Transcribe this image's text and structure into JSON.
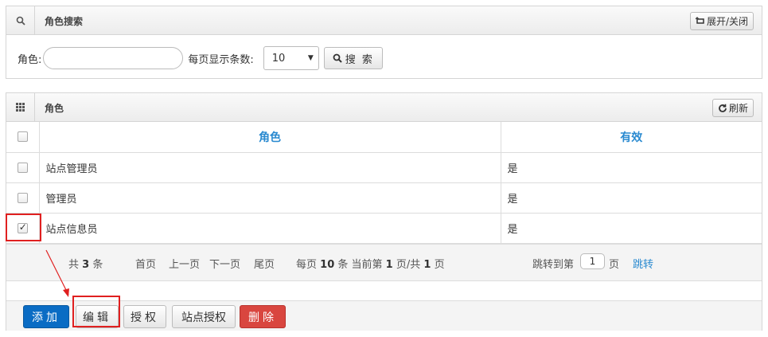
{
  "search_panel": {
    "title": "角色搜索",
    "toggle_label": "展开/关闭",
    "role_label": "角色:",
    "role_value": "",
    "page_size_label": "每页显示条数:",
    "page_size_value": "10",
    "search_label": "搜 索"
  },
  "roles_panel": {
    "title": "角色",
    "refresh_label": "刷新",
    "columns": [
      "角色",
      "有效"
    ],
    "rows": [
      {
        "role": "站点管理员",
        "valid": "是",
        "checked": false
      },
      {
        "role": "管理员",
        "valid": "是",
        "checked": false
      },
      {
        "role": "站点信息员",
        "valid": "是",
        "checked": true
      }
    ]
  },
  "pager": {
    "total_prefix": "共",
    "total": "3",
    "total_suffix": "条",
    "first": "首页",
    "prev": "上一页",
    "next": "下一页",
    "last": "尾页",
    "per_page_prefix": "每页",
    "per_page": "10",
    "per_page_mid": "条 当前第",
    "current_page": "1",
    "pages_mid": "页/共",
    "total_pages": "1",
    "pages_suffix": "页",
    "jump_prefix": "跳转到第",
    "jump_value": "1",
    "jump_suffix": "页",
    "jump_link": "跳转"
  },
  "toolbar": {
    "add": "添加",
    "edit": "编辑",
    "authorize": "授权",
    "site_authorize": "站点授权",
    "delete": "删除"
  },
  "colors": {
    "header_blue": "#2a8ad0",
    "primary": "#0a6cc4",
    "danger": "#d9463f",
    "highlight": "#e02020"
  }
}
